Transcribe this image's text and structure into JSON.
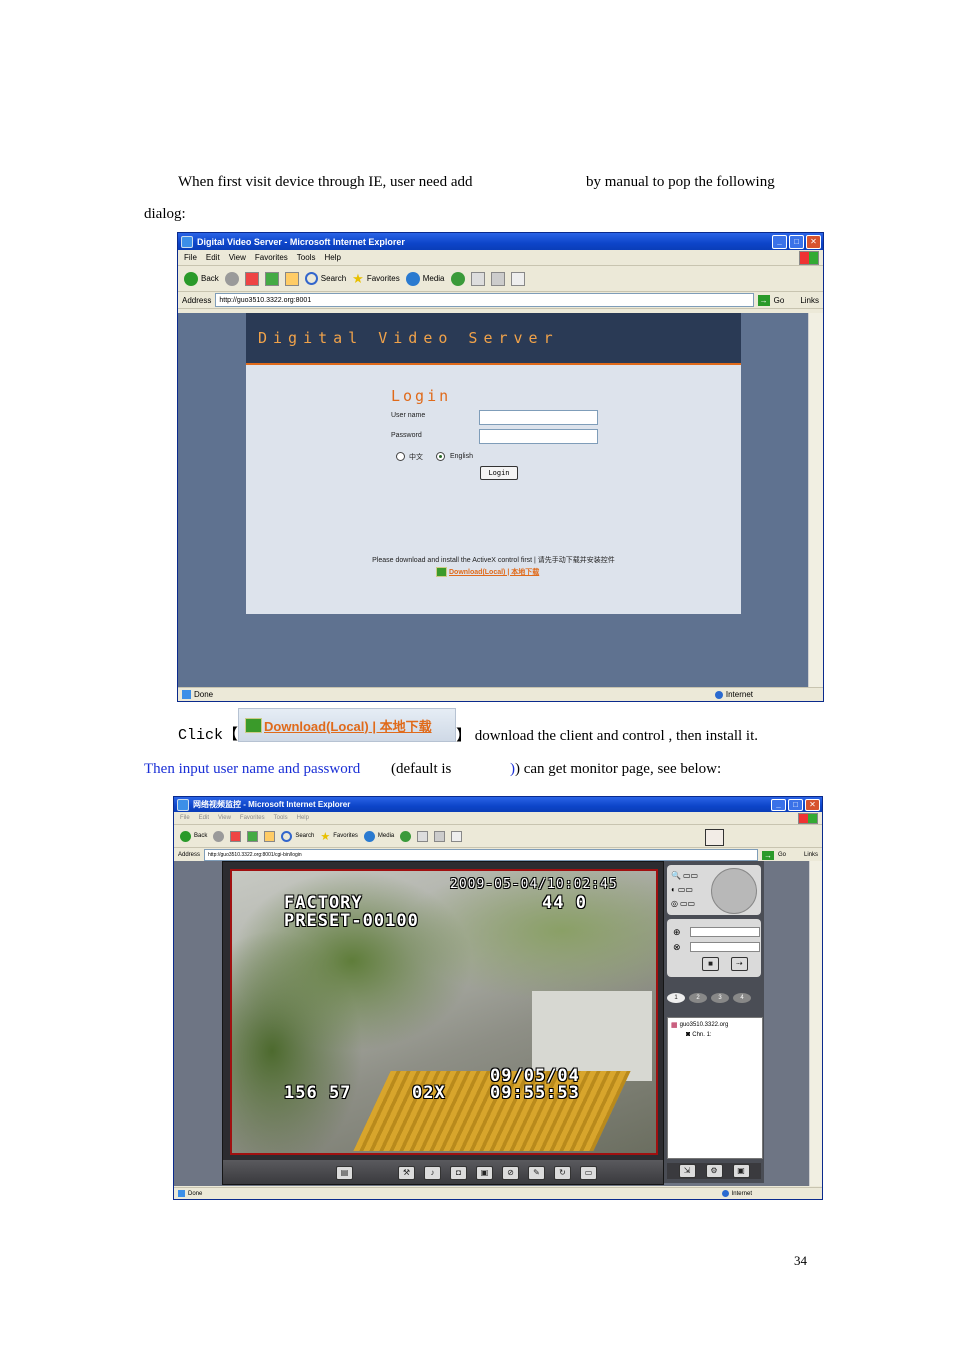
{
  "paragraph1": {
    "line1_a": "When  first  visit  device  through  IE,  user  need  add",
    "line1_b": "by  manual  to  pop  the  following",
    "line2": "dialog:"
  },
  "window1": {
    "title": "Digital Video Server - Microsoft Internet Explorer",
    "menu": [
      "File",
      "Edit",
      "View",
      "Favorites",
      "Tools",
      "Help"
    ],
    "toolbar": {
      "back": "Back",
      "search": "Search",
      "favorites": "Favorites",
      "media": "Media"
    },
    "address_label": "Address",
    "address": "http://guo3510.3322.org:8001",
    "go": "Go",
    "links": "Links",
    "page": {
      "header": "Digital Video Server",
      "login_title": "Login",
      "username_label": "User name",
      "password_label": "Password",
      "lang_cn": "中文",
      "lang_en": "English",
      "login_button": "Login",
      "notice": "Please download and install the ActiveX control first | 请先手动下载并安装控件",
      "download_link": "Download(Local) | 本地下载"
    },
    "status_left": "Done",
    "status_zone": "Internet"
  },
  "paragraph2": {
    "click": "Click【",
    "download_image_text": "Download(Local) | 本地下载",
    "after": "】  download the client and control , then install it.",
    "line2_blue": "Then input user name and password",
    "line2_rest1": "(default is",
    "line2_rest2": ") can get monitor page, see below:"
  },
  "window2": {
    "title": "网络视频监控 - Microsoft Internet Explorer",
    "menu": [
      "File",
      "Edit",
      "View",
      "Favorites",
      "Tools",
      "Help"
    ],
    "toolbar": {
      "back": "Back",
      "search": "Search",
      "favorites": "Favorites",
      "media": "Media"
    },
    "address_label": "Address",
    "address": "http://guo3510.3322.org:8001/cgi-bin/login",
    "go": "Go",
    "links": "Links",
    "osd": {
      "top_left_1": "FACTORY",
      "top_left_2": "PRESET-00100",
      "top_right_1": "2009-05-04/10:02:45",
      "top_right_2": "44 0",
      "bottom_1": "156 57",
      "bottom_2": "02X",
      "bottom_3": "09/05/04",
      "bottom_4": "09:55:53"
    },
    "channel_tabs": [
      "1",
      "2",
      "3",
      "4"
    ],
    "tree": {
      "root": "guo3510.3322.org",
      "child": "Chn. 1:"
    },
    "status_left": "Done",
    "status_zone": "Internet"
  },
  "page_number": "34"
}
